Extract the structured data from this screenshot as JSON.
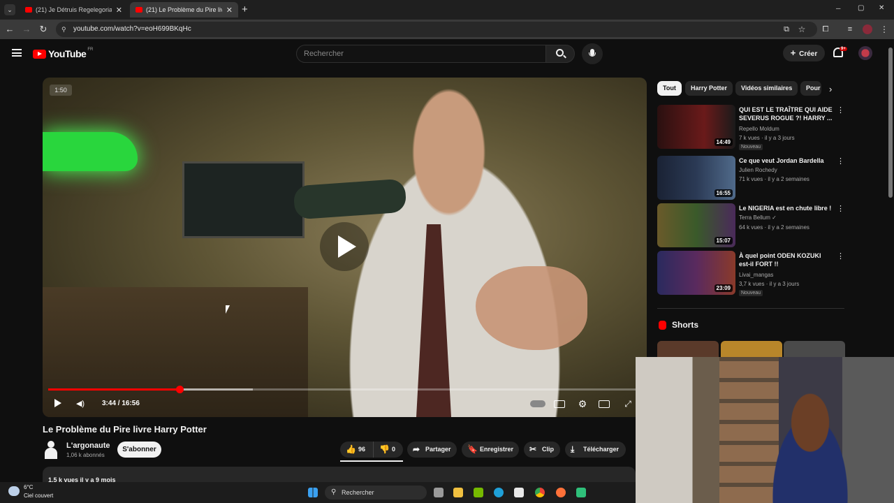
{
  "browser": {
    "tabs": [
      {
        "label": "(21) Je Détruis Regelegoria (ne",
        "active": false
      },
      {
        "label": "(21) Le Problème du Pire livre H",
        "active": true
      }
    ],
    "new_tab": "+",
    "url": "youtube.com/watch?v=eoH699BKqHc",
    "window_controls": {
      "minimize": "─",
      "maximize": "▢",
      "close": "✕"
    }
  },
  "header": {
    "logo": "YouTube",
    "region": "FR",
    "search_placeholder": "Rechercher",
    "create_label": "Créer",
    "notifications_badge": "9+"
  },
  "player": {
    "badge": "1:50",
    "time": "3:44 / 16:56",
    "progress": 0.221,
    "buffered": 0.345
  },
  "video": {
    "title": "Le Problème du Pire livre Harry Potter",
    "channel": "L'argonaute",
    "subscribers": "1,06 k abonnés",
    "subscribe_label": "S'abonner",
    "likes": "96",
    "dislikes": "0",
    "share_label": "Partager",
    "save_label": "Enregistrer",
    "clip_label": "Clip",
    "download_label": "Télécharger",
    "description_preview": "1,5 k vues  il y a 9 mois"
  },
  "sidebar": {
    "chips": [
      "Tout",
      "Harry Potter",
      "Vidéos similaires",
      "Pour"
    ],
    "recommendations": [
      {
        "title": "QUI EST LE TRAÎTRE QUI AIDE SEVERUS ROGUE ?! HARRY ...",
        "channel": "Repello Moldum",
        "meta": "7 k vues · il y a 3 jours",
        "badge": "Nouveau",
        "duration": "14:49",
        "thumb_color": "#6a1a1a"
      },
      {
        "title": "Ce que veut Jordan Bardella",
        "channel": "Julien Rochedy",
        "meta": "71 k vues · il y a 2 semaines",
        "badge": "",
        "duration": "16:55",
        "thumb_color": "#2b3a55"
      },
      {
        "title": "Le NIGERIA est en chute libre !",
        "channel": "Terra Bellum ✓",
        "meta": "64 k vues · il y a 2 semaines",
        "badge": "",
        "duration": "15:07",
        "thumb_color": "#3a5a2a"
      },
      {
        "title": "À quel point ODEN KOZUKI est-il FORT !!",
        "channel": "Livai_mangas",
        "meta": "3,7 k vues · il y a 3 jours",
        "badge": "Nouveau",
        "duration": "23:09",
        "thumb_color": "#5a2a5e"
      }
    ],
    "shorts_title": "Shorts"
  },
  "taskbar": {
    "weather_temp": "6°C",
    "weather_desc": "Ciel couvert",
    "search_placeholder": "Rechercher"
  },
  "colors": {
    "accent": "#ff0000",
    "background": "#0f0f0f",
    "surface": "#272727"
  }
}
